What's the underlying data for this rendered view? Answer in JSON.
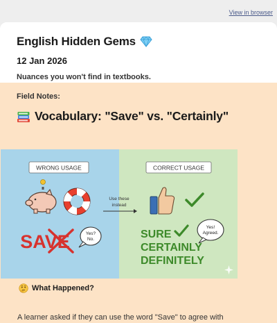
{
  "browser_link": "View in browser",
  "newsletter": {
    "name": "English Hidden Gems",
    "date": "12 Jan 2026",
    "tagline": "Nuances you won't find in textbooks."
  },
  "article": {
    "kicker": "Field Notes:",
    "title": "Vocabulary: \"Save\" vs. \"Certainly\"",
    "section_title": "What Happened?",
    "body_start": "A learner asked if they can use the word \"Save\" to agree with"
  },
  "illustration": {
    "wrong_label": "WRONG USAGE",
    "correct_label": "CORRECT USAGE",
    "arrow_label_1": "Use these",
    "arrow_label_2": "instead",
    "crossed_word": "SAVE",
    "wrong_bubble_1": "Yes?",
    "wrong_bubble_2": "No.",
    "right_bubble_1": "Yes!",
    "right_bubble_2": "Agreed.",
    "word_1": "SURE",
    "word_2": "CERTAINLY",
    "word_3": "DEFINITELY"
  },
  "colors": {
    "header_bg": "#ffffff",
    "body_bg": "#fde3c6",
    "wrong_panel": "#a8d4ea",
    "correct_panel": "#cfe7c0",
    "wrong_red": "#d7322e",
    "correct_green": "#3d8a2a"
  }
}
